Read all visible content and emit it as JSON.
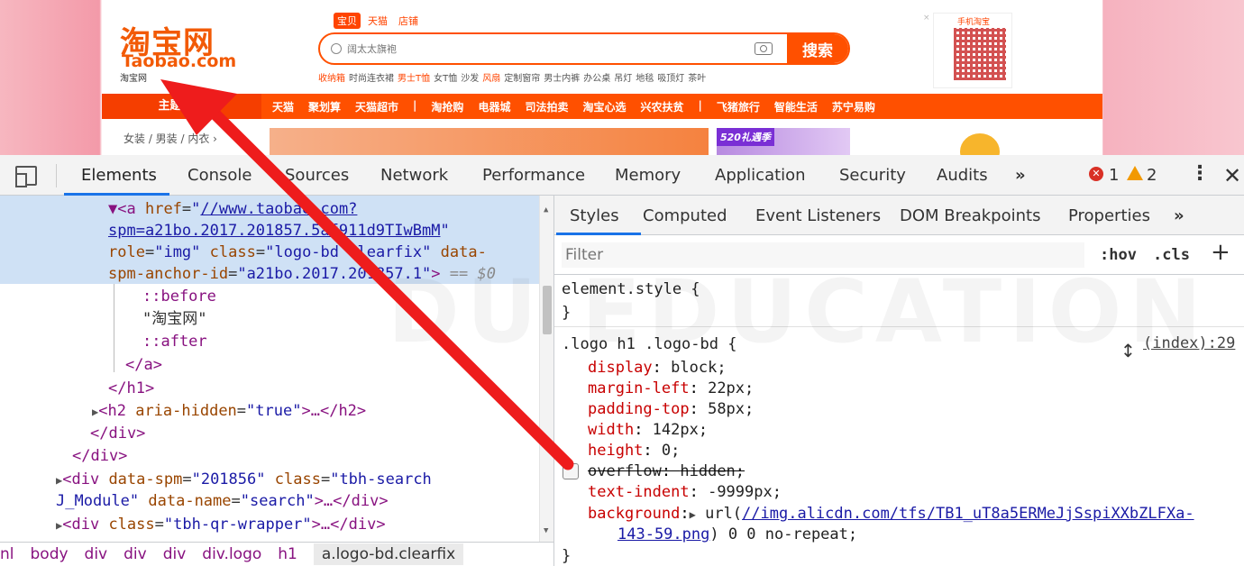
{
  "taobao": {
    "logo_title": "淘宝网",
    "logo_domain": "Taobao.com",
    "logo_sub": "淘宝网",
    "search_tabs": [
      "宝贝",
      "天猫",
      "店铺"
    ],
    "search_placeholder": "阔太太旗袍",
    "search_button": "搜索",
    "hot_words": [
      {
        "text": "收纳箱",
        "hl": true
      },
      {
        "text": "时尚连衣裙",
        "hl": false
      },
      {
        "text": "男士T恤",
        "hl": true
      },
      {
        "text": "女T恤",
        "hl": false
      },
      {
        "text": "沙发",
        "hl": false
      },
      {
        "text": "风扇",
        "hl": true
      },
      {
        "text": "定制窗帘",
        "hl": false
      },
      {
        "text": "男士内裤",
        "hl": false
      },
      {
        "text": "办公桌",
        "hl": false
      },
      {
        "text": "吊灯",
        "hl": false
      },
      {
        "text": "地毯",
        "hl": false
      },
      {
        "text": "吸顶灯",
        "hl": false
      },
      {
        "text": "茶叶",
        "hl": false
      }
    ],
    "qr_label": "手机淘宝",
    "qr_close": "×",
    "nav_main": "主题市场",
    "nav_items": [
      "天猫",
      "聚划算",
      "天猫超市",
      "|",
      "淘抢购",
      "电器城",
      "司法拍卖",
      "淘宝心选",
      "兴农扶贫",
      "|",
      "飞猪旅行",
      "智能生活",
      "苏宁易购"
    ],
    "category": "女装 / 男装 / 内衣 ›",
    "banner_tag": "520礼遇季",
    "brand_color": "#ff5000"
  },
  "devtools": {
    "tabs": [
      "Elements",
      "Console",
      "Sources",
      "Network",
      "Performance",
      "Memory",
      "Application",
      "Security",
      "Audits",
      "»"
    ],
    "error_count": "1",
    "warning_count": "2",
    "error_glyph": "✕",
    "kebab": "⋮",
    "close": "✕",
    "elements": {
      "a_tag_open": "▼<a",
      "href_attr": "href",
      "href_val_1": "//www.taobao.com?",
      "href_val_2": "spm=a21bo.2017.201857.5af911d9TIwBmM",
      "role_attr": "role",
      "role_val": "img",
      "class_attr": "class",
      "class_val": "logo-bd clearfix",
      "data_attr": "data-",
      "data_attr_2": "spm-anchor-id",
      "data_val": "a21bo.2017.201857.1",
      "eq0": "== $0",
      "before": "::before",
      "text_node": "\"淘宝网\"",
      "after": "::after",
      "a_close": "</a>",
      "h1_close": "</h1>",
      "h2_line_tag": "<h2",
      "h2_attr": "aria-hidden",
      "h2_val": "true",
      "h2_rest": ">…</h2>",
      "div_close_1": "</div>",
      "div_close_2": "</div>",
      "div1_open": "<div",
      "div1_attr1": "data-spm",
      "div1_val1": "201856",
      "div1_attr2": "class",
      "div1_val2_a": "tbh-search",
      "div1_val2_b": "J_Module",
      "div1_attr3": "data-name",
      "div1_val3": "search",
      "div1_rest": ">…</div>",
      "div2_open": "<div",
      "div2_attr": "class",
      "div2_val": "tbh-qr-wrapper",
      "div2_rest": ">…</div>"
    },
    "breadcrumb": [
      "nl",
      "body",
      "div",
      "div",
      "div",
      "div.logo",
      "h1",
      "a.logo-bd.clearfix"
    ],
    "styles": {
      "subtabs": [
        "Styles",
        "Computed",
        "Event Listeners",
        "DOM Breakpoints",
        "Properties",
        "»"
      ],
      "filter_placeholder": "Filter",
      "hov": ":hov",
      "cls": ".cls",
      "plus": "+",
      "element_style": "element.style {",
      "close_brace": "}",
      "rule_selector": ".logo h1 .logo-bd {",
      "rule_source": "(index):29",
      "decls": [
        {
          "name": "display",
          "value": "block;"
        },
        {
          "name": "margin-left",
          "value": "22px;"
        },
        {
          "name": "padding-top",
          "value": "58px;"
        },
        {
          "name": "width",
          "value": "142px;"
        },
        {
          "name": "height",
          "value": "0;"
        },
        {
          "name": "overflow",
          "value": "hidden;"
        },
        {
          "name": "text-indent",
          "value": "-9999px;"
        },
        {
          "name": "background",
          "value": "url("
        }
      ],
      "bg_url_1": "//img.alicdn.com/tfs/TB1_uT8a5ERMeJjSspiXXbZLFXa-",
      "bg_url_2": "143-59.png",
      "bg_tail": ") 0 0 no-repeat;"
    }
  },
  "watermark": "DU EDUCATION"
}
